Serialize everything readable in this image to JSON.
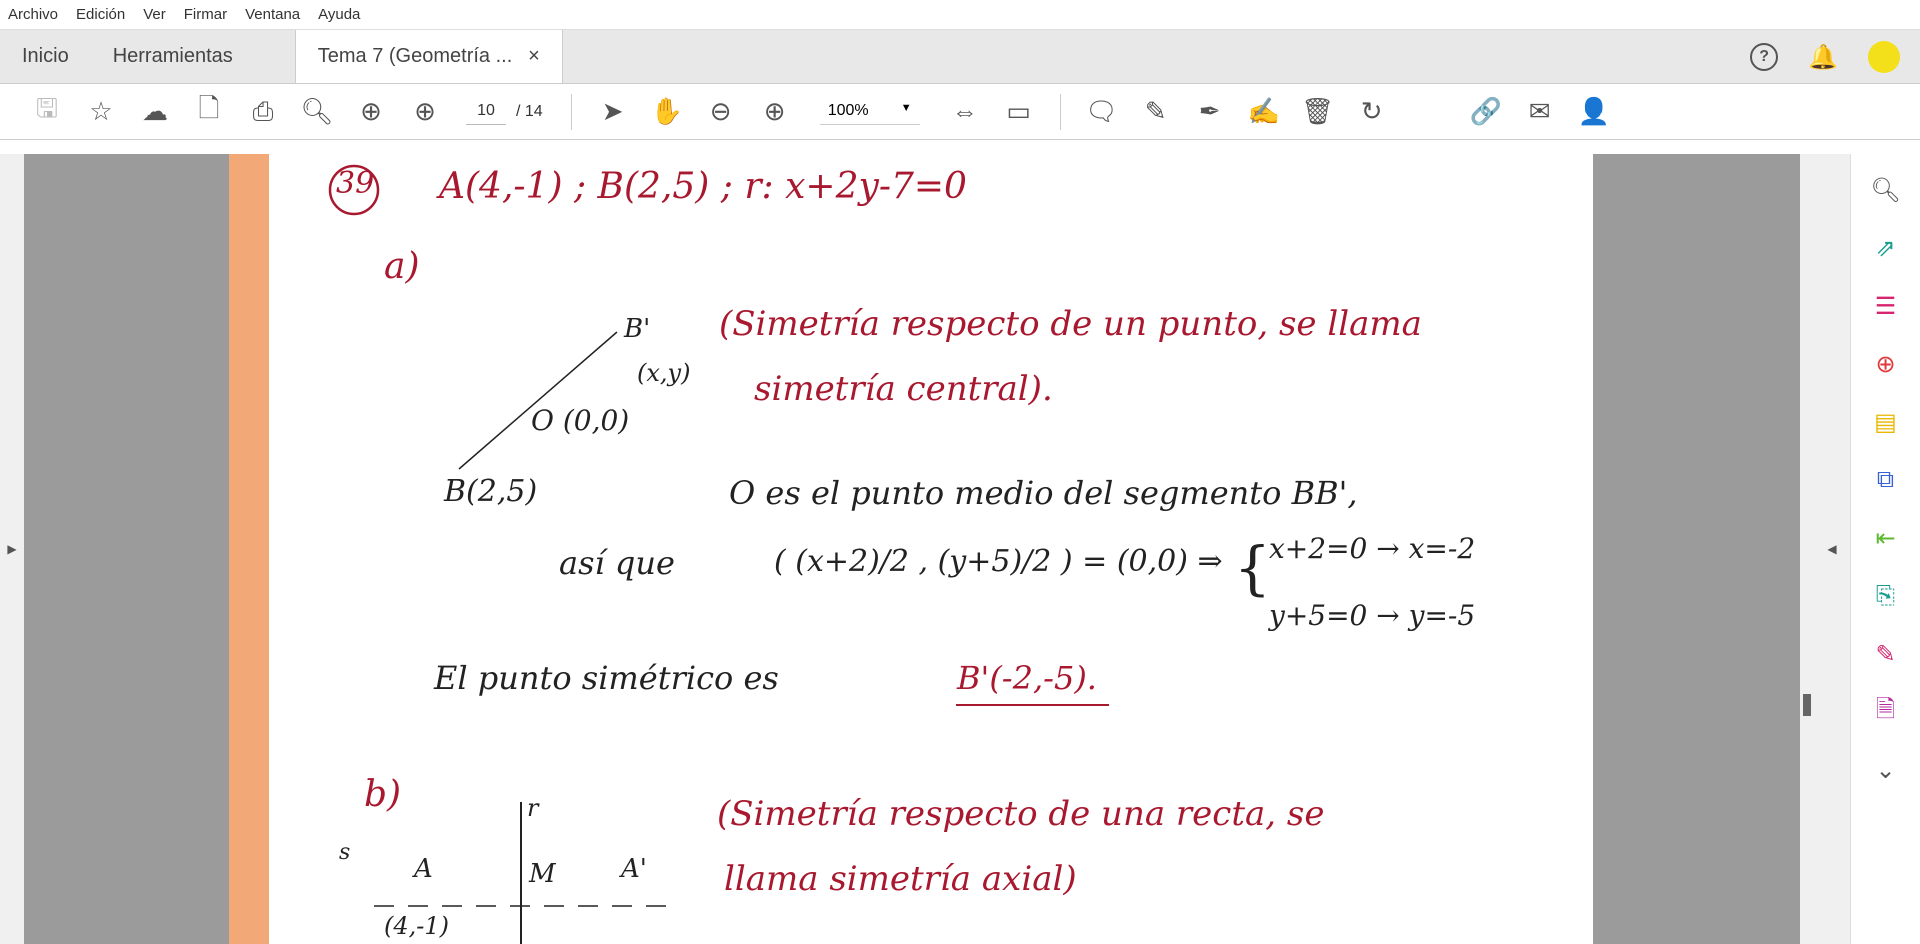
{
  "menu": [
    "Archivo",
    "Edición",
    "Ver",
    "Firmar",
    "Ventana",
    "Ayuda"
  ],
  "tabs": {
    "home": "Inicio",
    "tools": "Herramientas",
    "document": "Tema 7 (Geometría ...",
    "close": "×"
  },
  "toolbar": {
    "page_current": "10",
    "page_total": "/ 14",
    "zoom": "100%",
    "icons": [
      "save-icon",
      "star-icon",
      "cloud-upload-icon",
      "lock-file-icon",
      "print-icon",
      "search-icon",
      "page-up-icon",
      "page-down-icon",
      "pointer-icon",
      "hand-icon",
      "zoom-out-icon",
      "zoom-in-icon",
      "fit-page-icon",
      "measure-icon",
      "comment-icon",
      "highlight-icon",
      "sign-icon",
      "fill-sign-icon",
      "delete-icon",
      "rotate-icon",
      "link-icon",
      "email-icon",
      "add-user-icon"
    ]
  },
  "colors": {
    "accent": "#1473e6",
    "ink_red": "#a8182e",
    "strip": "#f3a878"
  },
  "page": {
    "problem": "39",
    "header": "A(4,-1) ; B(2,5) ; r: x+2y-7=0",
    "a_label": "a)",
    "b_prime": "B'",
    "b_prime_coord": "(x,y)",
    "o_point": "O (0,0)",
    "b_point": "B(2,5)",
    "a_note1": "(Simetría respecto de un punto, se llama",
    "a_note2": "simetría central).",
    "midpoint": "O es el punto medio del segmento BB',",
    "asi_que": "así que",
    "equation": "( (x+2)/2 , (y+5)/2 ) = (0,0) ⇒",
    "sys1": "x+2=0 → x=-2",
    "sys2": "y+5=0 → y=-5",
    "result_prefix": "El punto simétrico es",
    "result": "B'(-2,-5).",
    "b_label": "b)",
    "r": "r",
    "s": "s",
    "A": "A",
    "M": "M",
    "A_prime": "A'",
    "A_coord": "(4,-1)",
    "b_note1": "(Simetría respecto de una recta, se",
    "b_note2": "llama simetría axial)"
  }
}
